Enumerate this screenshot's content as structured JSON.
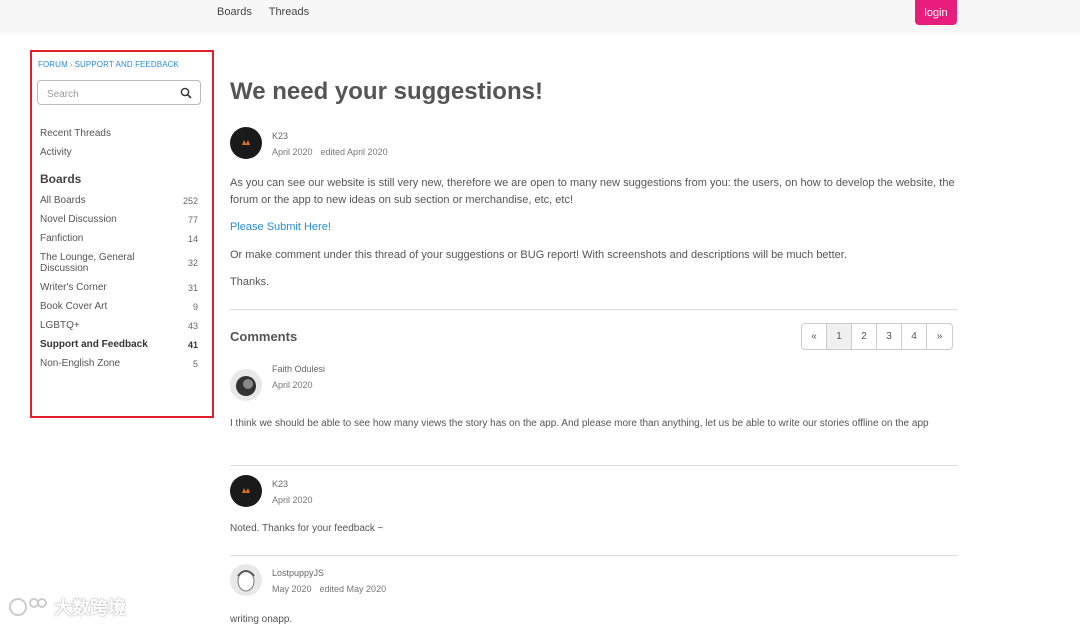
{
  "nav": {
    "links": [
      "Boards",
      "Threads"
    ],
    "login_label": "login"
  },
  "sidebar": {
    "breadcrumb": [
      "FORUM",
      "SUPPORT AND FEEDBACK"
    ],
    "search_placeholder": "Search",
    "links": [
      "Recent Threads",
      "Activity"
    ],
    "boards_heading": "Boards",
    "boards": [
      {
        "name": "All Boards",
        "count": "252"
      },
      {
        "name": "Novel Discussion",
        "count": "77"
      },
      {
        "name": "Fanfiction",
        "count": "14"
      },
      {
        "name": "The Lounge, General Discussion",
        "count": "32"
      },
      {
        "name": "Writer's Corner",
        "count": "31"
      },
      {
        "name": "Book Cover Art",
        "count": "9"
      },
      {
        "name": "LGBTQ+",
        "count": "43"
      },
      {
        "name": "Support and Feedback",
        "count": "41"
      },
      {
        "name": "Non-English Zone",
        "count": "5"
      }
    ],
    "active_board": "Support and Feedback"
  },
  "thread": {
    "title": "We need your suggestions!",
    "author": "K23",
    "date": "April 2020",
    "edited": "edited April 2020",
    "paragraphs": [
      "As you can see our website is still very new, therefore we are open to many new suggestions from you: the users, on how to develop the website, the forum or the app to new ideas on sub section or merchandise, etc, etc!",
      "Please Submit Here!",
      "Or make comment under this thread of your suggestions or BUG report! With screenshots and descriptions will be much better.",
      "Thanks."
    ]
  },
  "comments": {
    "heading": "Comments",
    "pager": [
      "«",
      "1",
      "2",
      "3",
      "4",
      "»"
    ],
    "current_page": "1",
    "items": [
      {
        "author": "Faith Odulesi",
        "date": "April 2020",
        "edited": "",
        "text": "I think we should be able to see how many views the story has on the app. And please more than anything, let us be able to write our stories offline on the app"
      },
      {
        "author": "K23",
        "date": "April 2020",
        "edited": "",
        "text": "Noted. Thanks for your feedback ~"
      },
      {
        "author": "LostpuppyJS",
        "date": "May 2020",
        "edited": "edited May 2020",
        "text": "writing onapp."
      }
    ]
  },
  "watermark": "大数跨境",
  "colors": {
    "login": "#e91e7c",
    "link": "#2b8bd6",
    "highlight_border": "#e0202a"
  }
}
